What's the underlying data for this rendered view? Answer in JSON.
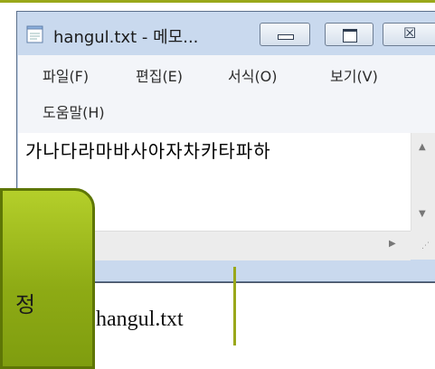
{
  "window": {
    "title": "hangul.txt - 메모...",
    "minimize_symbol": "",
    "maximize_symbol": "",
    "close_symbol": "☒"
  },
  "menu": [
    "파일(F)",
    "편집(E)",
    "서식(O)",
    "보기(V)",
    "도움말(H)"
  ],
  "editor": {
    "content": "가나다라마바사아자차카타파하"
  },
  "scrollbar": {
    "up_arrow": "▲",
    "down_arrow": "▼",
    "right_arrow": "▶",
    "grip": "⋰"
  },
  "callout": {
    "text": "정"
  },
  "caption": {
    "filename": "hangul.txt"
  },
  "colors": {
    "accent_green": "#9aa81a",
    "window_blue": "#c9d9ee"
  }
}
